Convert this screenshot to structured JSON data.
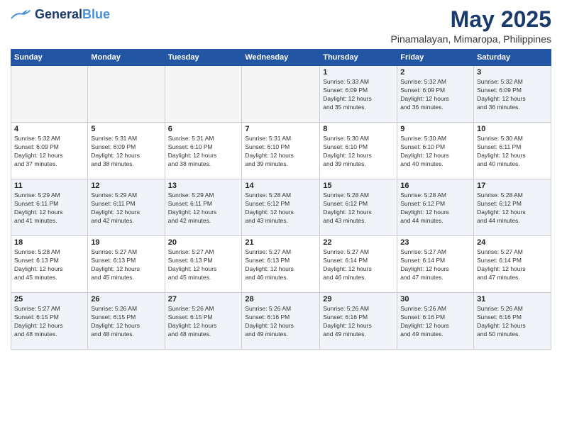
{
  "header": {
    "logo_general": "General",
    "logo_blue": "Blue",
    "month": "May 2025",
    "location": "Pinamalayan, Mimaropa, Philippines"
  },
  "weekdays": [
    "Sunday",
    "Monday",
    "Tuesday",
    "Wednesday",
    "Thursday",
    "Friday",
    "Saturday"
  ],
  "weeks": [
    [
      {
        "day": "",
        "info": ""
      },
      {
        "day": "",
        "info": ""
      },
      {
        "day": "",
        "info": ""
      },
      {
        "day": "",
        "info": ""
      },
      {
        "day": "1",
        "info": "Sunrise: 5:33 AM\nSunset: 6:09 PM\nDaylight: 12 hours\nand 35 minutes."
      },
      {
        "day": "2",
        "info": "Sunrise: 5:32 AM\nSunset: 6:09 PM\nDaylight: 12 hours\nand 36 minutes."
      },
      {
        "day": "3",
        "info": "Sunrise: 5:32 AM\nSunset: 6:09 PM\nDaylight: 12 hours\nand 36 minutes."
      }
    ],
    [
      {
        "day": "4",
        "info": "Sunrise: 5:32 AM\nSunset: 6:09 PM\nDaylight: 12 hours\nand 37 minutes."
      },
      {
        "day": "5",
        "info": "Sunrise: 5:31 AM\nSunset: 6:09 PM\nDaylight: 12 hours\nand 38 minutes."
      },
      {
        "day": "6",
        "info": "Sunrise: 5:31 AM\nSunset: 6:10 PM\nDaylight: 12 hours\nand 38 minutes."
      },
      {
        "day": "7",
        "info": "Sunrise: 5:31 AM\nSunset: 6:10 PM\nDaylight: 12 hours\nand 39 minutes."
      },
      {
        "day": "8",
        "info": "Sunrise: 5:30 AM\nSunset: 6:10 PM\nDaylight: 12 hours\nand 39 minutes."
      },
      {
        "day": "9",
        "info": "Sunrise: 5:30 AM\nSunset: 6:10 PM\nDaylight: 12 hours\nand 40 minutes."
      },
      {
        "day": "10",
        "info": "Sunrise: 5:30 AM\nSunset: 6:11 PM\nDaylight: 12 hours\nand 40 minutes."
      }
    ],
    [
      {
        "day": "11",
        "info": "Sunrise: 5:29 AM\nSunset: 6:11 PM\nDaylight: 12 hours\nand 41 minutes."
      },
      {
        "day": "12",
        "info": "Sunrise: 5:29 AM\nSunset: 6:11 PM\nDaylight: 12 hours\nand 42 minutes."
      },
      {
        "day": "13",
        "info": "Sunrise: 5:29 AM\nSunset: 6:11 PM\nDaylight: 12 hours\nand 42 minutes."
      },
      {
        "day": "14",
        "info": "Sunrise: 5:28 AM\nSunset: 6:12 PM\nDaylight: 12 hours\nand 43 minutes."
      },
      {
        "day": "15",
        "info": "Sunrise: 5:28 AM\nSunset: 6:12 PM\nDaylight: 12 hours\nand 43 minutes."
      },
      {
        "day": "16",
        "info": "Sunrise: 5:28 AM\nSunset: 6:12 PM\nDaylight: 12 hours\nand 44 minutes."
      },
      {
        "day": "17",
        "info": "Sunrise: 5:28 AM\nSunset: 6:12 PM\nDaylight: 12 hours\nand 44 minutes."
      }
    ],
    [
      {
        "day": "18",
        "info": "Sunrise: 5:28 AM\nSunset: 6:13 PM\nDaylight: 12 hours\nand 45 minutes."
      },
      {
        "day": "19",
        "info": "Sunrise: 5:27 AM\nSunset: 6:13 PM\nDaylight: 12 hours\nand 45 minutes."
      },
      {
        "day": "20",
        "info": "Sunrise: 5:27 AM\nSunset: 6:13 PM\nDaylight: 12 hours\nand 45 minutes."
      },
      {
        "day": "21",
        "info": "Sunrise: 5:27 AM\nSunset: 6:13 PM\nDaylight: 12 hours\nand 46 minutes."
      },
      {
        "day": "22",
        "info": "Sunrise: 5:27 AM\nSunset: 6:14 PM\nDaylight: 12 hours\nand 46 minutes."
      },
      {
        "day": "23",
        "info": "Sunrise: 5:27 AM\nSunset: 6:14 PM\nDaylight: 12 hours\nand 47 minutes."
      },
      {
        "day": "24",
        "info": "Sunrise: 5:27 AM\nSunset: 6:14 PM\nDaylight: 12 hours\nand 47 minutes."
      }
    ],
    [
      {
        "day": "25",
        "info": "Sunrise: 5:27 AM\nSunset: 6:15 PM\nDaylight: 12 hours\nand 48 minutes."
      },
      {
        "day": "26",
        "info": "Sunrise: 5:26 AM\nSunset: 6:15 PM\nDaylight: 12 hours\nand 48 minutes."
      },
      {
        "day": "27",
        "info": "Sunrise: 5:26 AM\nSunset: 6:15 PM\nDaylight: 12 hours\nand 48 minutes."
      },
      {
        "day": "28",
        "info": "Sunrise: 5:26 AM\nSunset: 6:16 PM\nDaylight: 12 hours\nand 49 minutes."
      },
      {
        "day": "29",
        "info": "Sunrise: 5:26 AM\nSunset: 6:16 PM\nDaylight: 12 hours\nand 49 minutes."
      },
      {
        "day": "30",
        "info": "Sunrise: 5:26 AM\nSunset: 6:16 PM\nDaylight: 12 hours\nand 49 minutes."
      },
      {
        "day": "31",
        "info": "Sunrise: 5:26 AM\nSunset: 6:16 PM\nDaylight: 12 hours\nand 50 minutes."
      }
    ]
  ]
}
